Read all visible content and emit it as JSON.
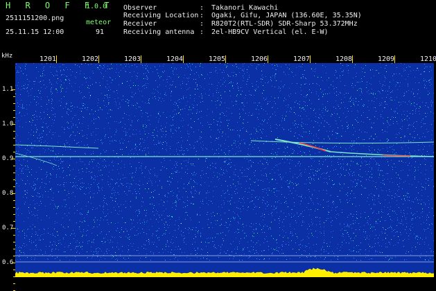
{
  "header": {
    "app_name": "H R O F F T",
    "version": "1.0.0",
    "filename": "2511151200.png",
    "mode": "meteor",
    "datetime": "25.11.15 12:00",
    "count": "91"
  },
  "meta": [
    {
      "key": "Observer",
      "value": "Takanori Kawachi"
    },
    {
      "key": "Receiving Location",
      "value": "Ogaki, Gifu, JAPAN (136.60E, 35.35N)"
    },
    {
      "key": "Receiver",
      "value": "R820T2(RTL-SDR) SDR-Sharp 53.372MHz"
    },
    {
      "key": "Receiving antenna",
      "value": "2el-HB9CV Vertical (el. E-W)"
    }
  ],
  "axis": {
    "unit": "kHz",
    "time_labels": [
      "1201",
      "1202",
      "1203",
      "1204",
      "1205",
      "1206",
      "1207",
      "1208",
      "1209",
      "1210"
    ],
    "freq_labels": [
      "1.1",
      "1.0",
      "0.9",
      "0.8",
      "0.7",
      "0.6"
    ],
    "freq_values": [
      1.1,
      1.0,
      0.9,
      0.8,
      0.7,
      0.6
    ]
  },
  "colors": {
    "background": "#0b2fa4",
    "noise_colors": [
      "#2a6ae8",
      "#4a90ff",
      "#1fd6d6",
      "#3cff8a",
      "#9bffb0"
    ],
    "carrier": "#7de8c8",
    "meteor_hot": "#ff3a3a",
    "tick": "#ffe000",
    "bottom_bar": "#ffee00"
  }
}
